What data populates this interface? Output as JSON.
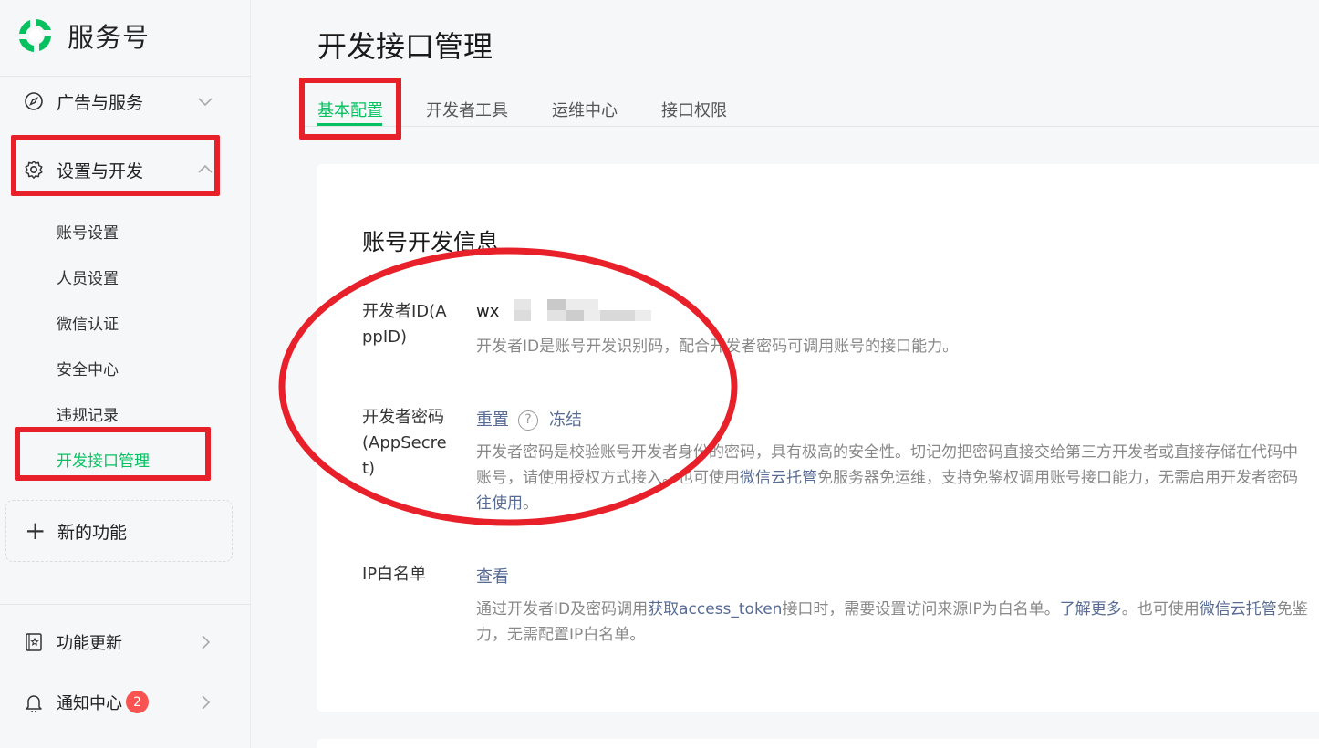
{
  "brand": {
    "name": "服务号"
  },
  "sidebar": {
    "items": [
      {
        "label": "广告与服务",
        "icon": "compass-icon"
      },
      {
        "label": "设置与开发",
        "icon": "gear-icon"
      }
    ],
    "sub_items": [
      "账号设置",
      "人员设置",
      "微信认证",
      "安全中心",
      "违规记录",
      "开发接口管理"
    ],
    "new_feature": "新的功能",
    "bottom_items": [
      {
        "label": "功能更新",
        "icon": "update-book-icon"
      },
      {
        "label": "通知中心",
        "icon": "bell-icon",
        "badge": "2"
      }
    ]
  },
  "main": {
    "title": "开发接口管理",
    "tabs": [
      "基本配置",
      "开发者工具",
      "运维中心",
      "接口权限"
    ],
    "section_title": "账号开发信息",
    "rows": {
      "appid": {
        "label": "开发者ID(AppID)",
        "value_prefix": "wx",
        "desc": "开发者ID是账号开发识别码，配合开发者密码可调用账号的接口能力。"
      },
      "secret": {
        "label": "开发者密码(AppSecret)",
        "reset": "重置",
        "help": "?",
        "freeze": "冻结",
        "desc_line1": "开发者密码是校验账号开发者身份的密码，具有极高的安全性。切记勿把密码直接交给第三方开发者或直接存储在代码中",
        "desc_line2_a": "账号，请使用授权方式接入。也可使用",
        "desc_line2_link": "微信云托管",
        "desc_line2_b": "免服务器免运维，支持免鉴权调用账号接口能力，无需启用开发者密码",
        "desc_line3_link": "往使用",
        "desc_line3_end": "。"
      },
      "ip": {
        "label": "IP白名单",
        "view": "查看",
        "desc_line1_a": "通过开发者ID及密码调用",
        "desc_line1_link1": "获取access_token",
        "desc_line1_b": "接口时，需要设置访问来源IP为白名单。",
        "desc_line1_link2": "了解更多",
        "desc_line1_c": "。也可使用",
        "desc_line1_link3": "微信云托管",
        "desc_line1_d": "免鉴",
        "desc_line2": "力，无需配置IP白名单。"
      }
    }
  },
  "colors": {
    "accent": "#07c160",
    "link": "#576b95",
    "annotation": "#e8202a",
    "badge": "#fa5151"
  }
}
